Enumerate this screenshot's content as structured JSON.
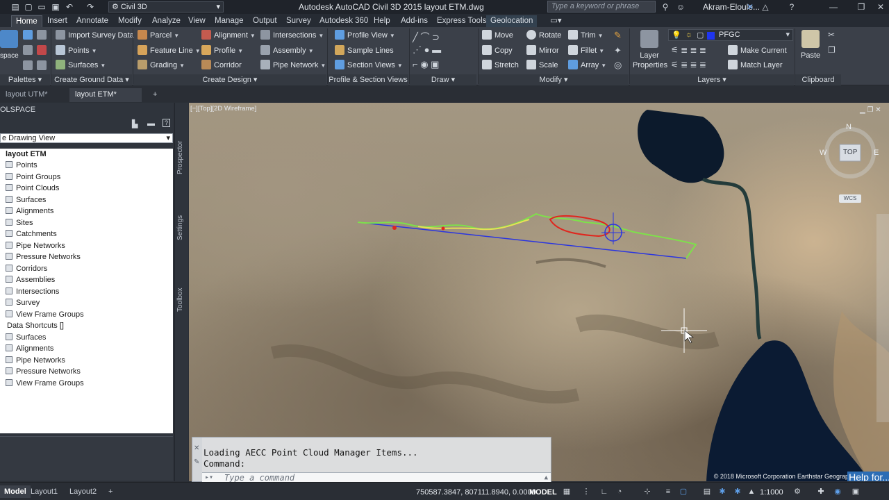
{
  "titlebar": {
    "workspace": "Civil 3D",
    "app_title": "Autodesk AutoCAD Civil 3D 2015     layout ETM.dwg",
    "search_placeholder": "Type a keyword or phrase",
    "user": "Akram-Eloule..."
  },
  "tabs": [
    "Home",
    "Insert",
    "Annotate",
    "Modify",
    "Analyze",
    "View",
    "Manage",
    "Output",
    "Survey",
    "Autodesk 360",
    "Help",
    "Add-ins",
    "Express Tools",
    "Geolocation"
  ],
  "ribbon": {
    "toolspace_label": "space",
    "import_survey": "Import Survey Data",
    "points": "Points",
    "surfaces": "Surfaces",
    "parcel": "Parcel",
    "feature_line": "Feature Line",
    "grading": "Grading",
    "alignment": "Alignment",
    "profile": "Profile",
    "corridor": "Corridor",
    "intersections": "Intersections",
    "assembly": "Assembly",
    "pipe_network": "Pipe Network",
    "profile_view": "Profile View",
    "sample_lines": "Sample Lines",
    "section_views": "Section Views",
    "move": "Move",
    "copy": "Copy",
    "stretch": "Stretch",
    "rotate": "Rotate",
    "mirror": "Mirror",
    "scale": "Scale",
    "trim": "Trim",
    "fillet": "Fillet",
    "array": "Array",
    "layer_properties": "Layer Properties",
    "layer_name": "PFGC",
    "make_current": "Make Current",
    "match_layer": "Match Layer",
    "paste": "Paste",
    "panels": {
      "palettes": "Palettes",
      "create_ground_data": "Create Ground Data",
      "create_design": "Create Design",
      "profile_section_views": "Profile & Section Views",
      "draw": "Draw",
      "modify": "Modify",
      "layers": "Layers",
      "clipboard": "Clipboard"
    }
  },
  "doc_tabs": [
    "layout UTM*",
    "layout ETM*"
  ],
  "palette": {
    "title": "OLSPACE",
    "view_select": "e Drawing View",
    "side_tabs": [
      "Prospector",
      "Settings",
      "Toolbox"
    ],
    "root": "layout ETM",
    "items": [
      "Points",
      "Point Groups",
      "Point Clouds",
      "Surfaces",
      "Alignments",
      "Sites",
      "Catchments",
      "Pipe Networks",
      "Pressure Networks",
      "Corridors",
      "Assemblies",
      "Intersections",
      "Survey",
      "View Frame Groups"
    ],
    "shortcuts_root": "Data Shortcuts []",
    "shortcut_items": [
      "Surfaces",
      "Alignments",
      "Pipe Networks",
      "Pressure Networks",
      "View Frame Groups"
    ]
  },
  "viewport": {
    "label": "[−][Top][2D Wireframe]",
    "compass": {
      "n": "N",
      "w": "W",
      "e": "E",
      "top": "TOP",
      "wcs": "WCS"
    },
    "copyright": "© 2018 Microsoft Corporation Earthstar Geographics SIO",
    "help_link": "Help for..."
  },
  "command": {
    "history_1": "Loading AECC Point Cloud Manager Items...",
    "history_2": "Command:",
    "placeholder": "Type a command"
  },
  "status": {
    "layout_tabs": [
      "Model",
      "Layout1",
      "Layout2"
    ],
    "coords": "750587.3847, 807111.8940, 0.0000",
    "model": "MODEL",
    "scale": "1:1000"
  },
  "colors": {
    "alignment_blue": "#2a35e0",
    "route_green": "#7ee14a",
    "route_yellow": "#e6df58",
    "route_red": "#e0261e",
    "sea": "#0c1d35",
    "ribbon_bg": "#3b4049"
  }
}
